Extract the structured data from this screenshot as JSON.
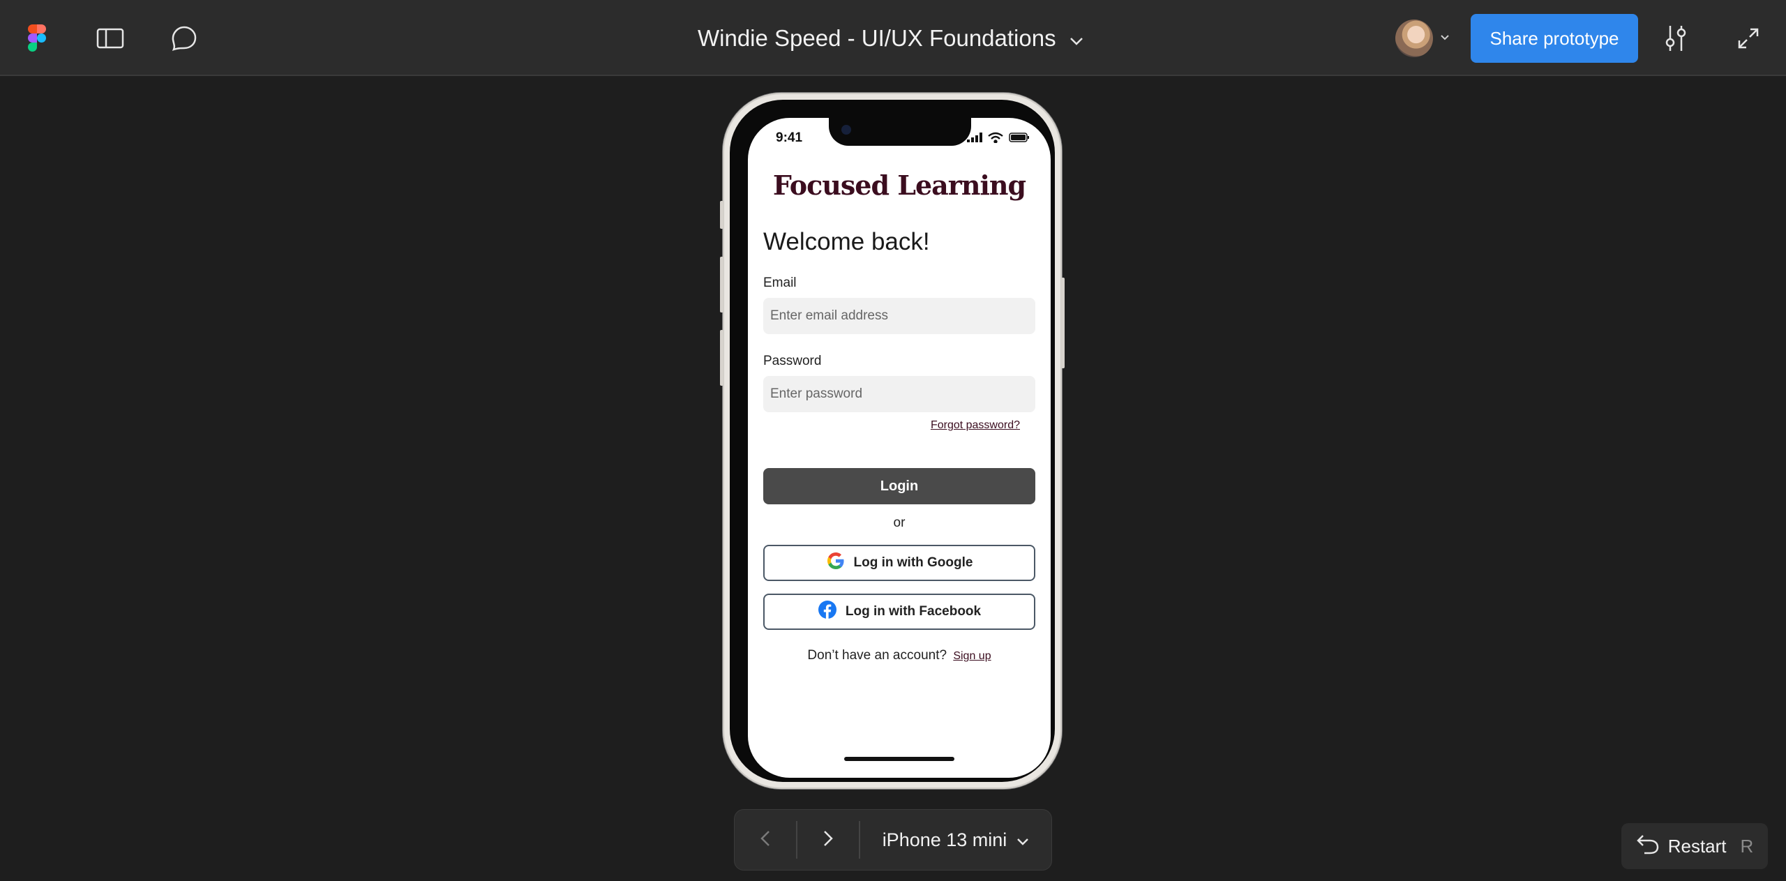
{
  "app": {
    "file_title": "Windie Speed - UI/UX Foundations",
    "share_label": "Share prototype"
  },
  "icons": {
    "logo": "figma-logo-icon",
    "sidebar": "sidebar-panel-icon",
    "comment": "comment-bubble-icon",
    "title_dropdown": "chevron-down-icon",
    "settings": "sliders-icon",
    "expand": "expand-icon",
    "prev": "chevron-left-icon",
    "next": "chevron-right-icon",
    "restart": "restart-icon"
  },
  "colors": {
    "toolbar": "#2c2c2c",
    "canvas": "#1e1e1e",
    "share_button": "#2f86eb",
    "brand": "#3b0d1f",
    "login_button": "#4a4a4a"
  },
  "phone_screen": {
    "status_time": "9:41",
    "logo_text": "Focused Learning",
    "heading": "Welcome back!",
    "email_label": "Email",
    "email_placeholder": "Enter email address",
    "password_label": "Password",
    "password_placeholder": "Enter password",
    "forgot_password": "Forgot password?",
    "login_button": "Login",
    "divider_text": "or",
    "google_button": "Log in with Google",
    "facebook_button": "Log in with Facebook",
    "signup_prompt": "Don’t have an account?",
    "signup_link": "Sign up"
  },
  "navigator": {
    "device": "iPhone 13 mini"
  },
  "restart": {
    "label": "Restart",
    "shortcut": "R"
  }
}
